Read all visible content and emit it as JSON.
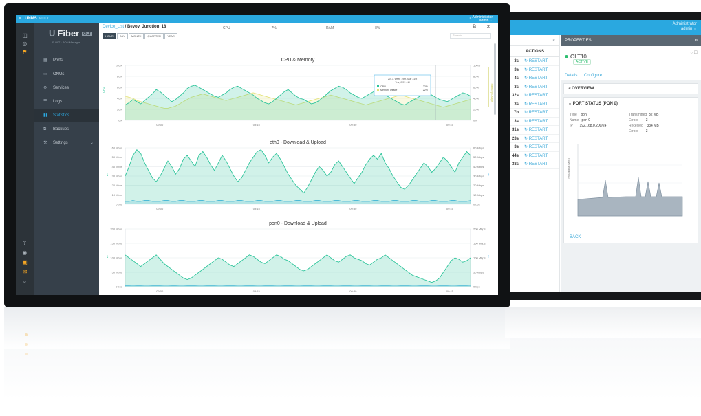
{
  "app": {
    "brand": "UNMS",
    "version": "v1.0.x",
    "user_role": "Administrator",
    "user_name": "admin"
  },
  "logo": {
    "name": "Fiber",
    "badge": "OLT",
    "subtitle": "IP OLT · PON Manager"
  },
  "sidebar": {
    "items": [
      {
        "label": "Ports",
        "icon": "ports-icon"
      },
      {
        "label": "ONUs",
        "icon": "onu-icon"
      },
      {
        "label": "Services",
        "icon": "services-icon"
      },
      {
        "label": "Logs",
        "icon": "logs-icon"
      },
      {
        "label": "Statistics",
        "icon": "statistics-icon",
        "active": true
      },
      {
        "label": "Backups",
        "icon": "backups-icon"
      },
      {
        "label": "Settings",
        "icon": "settings-icon"
      }
    ]
  },
  "header": {
    "breadcrumb_root": "Device_List",
    "breadcrumb_sep": " / ",
    "breadcrumb_current": "Bevov_Junction_18",
    "cpu_label": "CPU",
    "cpu_value": "7%",
    "ram_label": "RAM",
    "ram_value": "8%",
    "range_tabs": [
      "HOUR",
      "DAY",
      "MONTH",
      "QUARTER",
      "YEAR"
    ],
    "active_range": "HOUR",
    "filter_placeholder": "Search"
  },
  "tooltip": {
    "title": "2017, week 19th, Mar 31st",
    "subtitle": "Tue, 9:52 AM",
    "series": [
      {
        "name": "CPU",
        "value": "22%"
      },
      {
        "name": "Memory Usage",
        "value": "22%"
      }
    ]
  },
  "colors": {
    "accent": "#2aa8e0",
    "sidebar": "#36404a",
    "series_green": "#2cc49a",
    "series_yellow": "#e4e37a",
    "series_blue": "#56b8e8"
  },
  "chart_data": [
    {
      "type": "area",
      "title": "CPU & Memory",
      "x": [
        "09:00",
        "09:15",
        "09:30",
        "09:45"
      ],
      "y_ticks": [
        "0%",
        "20%",
        "40%",
        "60%",
        "80%",
        "100%"
      ],
      "ylim": [
        0,
        100
      ],
      "ylabel": "CPU",
      "y2label": "Memory Usage",
      "series": [
        {
          "name": "CPU",
          "values": [
            28,
            32,
            38,
            34,
            30,
            36,
            42,
            48,
            56,
            52,
            46,
            40,
            34,
            38,
            44,
            50,
            58,
            62,
            64,
            60,
            56,
            52,
            48,
            44,
            42,
            46,
            50,
            56,
            60,
            62,
            58,
            54,
            50,
            46,
            40,
            36,
            32,
            30,
            34,
            40,
            46,
            52,
            56,
            50,
            44,
            40,
            38,
            34,
            30,
            32,
            36,
            42,
            48,
            54,
            58,
            62,
            60,
            56,
            50,
            46,
            42,
            40,
            44,
            48,
            52,
            54,
            50,
            46,
            42,
            38,
            34,
            30,
            28,
            32,
            36,
            40,
            44,
            48,
            50,
            46,
            42,
            38,
            36,
            34,
            38,
            42,
            46,
            50,
            48,
            44
          ]
        },
        {
          "name": "Memory Usage",
          "values": [
            44,
            42,
            40,
            36,
            34,
            32,
            30,
            28,
            26,
            24,
            22,
            22,
            24,
            26,
            30,
            34,
            38,
            42,
            44,
            46,
            48,
            46,
            44,
            42,
            40,
            38,
            36,
            38,
            40,
            42,
            44,
            46,
            48,
            50,
            48,
            46,
            44,
            42,
            40,
            38,
            36,
            34,
            32,
            30,
            28,
            30,
            32,
            34,
            36,
            38,
            40,
            42,
            44,
            46,
            44,
            42,
            40,
            38,
            36,
            34,
            32,
            30,
            28,
            30,
            32,
            34,
            36,
            38,
            40,
            42,
            44,
            46,
            44,
            42,
            40,
            38,
            36,
            34,
            32,
            30,
            28,
            26,
            24,
            26,
            28,
            30,
            32,
            34,
            36,
            38
          ]
        }
      ]
    },
    {
      "type": "area",
      "title": "eth0 - Download & Upload",
      "x": [
        "09:00",
        "09:15",
        "09:30",
        "09:45"
      ],
      "y_ticks": [
        "0 bps",
        "10 Mbps",
        "20 Mbps",
        "30 Mbps",
        "40 Mbps",
        "50 Mbps",
        "60 Mbps"
      ],
      "ylim": [
        0,
        60
      ],
      "series": [
        {
          "name": "Download",
          "values": [
            30,
            40,
            52,
            58,
            54,
            44,
            36,
            28,
            24,
            30,
            38,
            46,
            40,
            32,
            38,
            48,
            52,
            46,
            40,
            52,
            56,
            50,
            42,
            36,
            44,
            52,
            46,
            38,
            30,
            24,
            28,
            36,
            44,
            50,
            56,
            58,
            52,
            44,
            50,
            54,
            48,
            40,
            32,
            26,
            20,
            16,
            12,
            18,
            26,
            34,
            40,
            36,
            30,
            34,
            42,
            46,
            40,
            34,
            28,
            22,
            28,
            34,
            42,
            48,
            52,
            48,
            54,
            44,
            38,
            30,
            24,
            18,
            16,
            20,
            26,
            32,
            38,
            44,
            40,
            34,
            38,
            44,
            50,
            46,
            40,
            34,
            44,
            50,
            56,
            52
          ]
        },
        {
          "name": "Upload",
          "values": [
            3,
            3,
            4,
            3,
            3,
            4,
            4,
            3,
            3,
            3,
            4,
            4,
            3,
            3,
            4,
            4,
            3,
            3,
            3,
            4,
            4,
            3,
            3,
            3,
            4,
            4,
            3,
            3,
            3,
            4,
            4,
            3,
            3,
            3,
            4,
            4,
            3,
            3,
            3,
            4,
            4,
            3,
            3,
            3,
            4,
            4,
            3,
            3,
            3,
            4,
            4,
            3,
            3,
            3,
            4,
            4,
            3,
            3,
            3,
            4,
            4,
            3,
            3,
            3,
            4,
            4,
            3,
            3,
            3,
            4,
            4,
            3,
            3,
            3,
            4,
            4,
            3,
            3,
            3,
            4,
            4,
            3,
            3,
            3,
            4,
            4,
            3,
            3,
            3,
            4
          ]
        }
      ]
    },
    {
      "type": "area",
      "title": "pon0 - Download & Upload",
      "x": [
        "09:00",
        "09:15",
        "09:30",
        "09:45"
      ],
      "y_ticks": [
        "0 bps",
        "50 Mbps",
        "100 Mbps",
        "150 Mbps",
        "200 Mbps"
      ],
      "ylim": [
        0,
        200
      ],
      "series": [
        {
          "name": "Download",
          "values": [
            110,
            100,
            90,
            80,
            70,
            80,
            90,
            100,
            110,
            95,
            80,
            70,
            60,
            50,
            40,
            30,
            25,
            30,
            40,
            50,
            60,
            70,
            80,
            90,
            100,
            95,
            85,
            75,
            70,
            80,
            90,
            100,
            110,
            105,
            95,
            85,
            80,
            90,
            100,
            110,
            105,
            95,
            90,
            80,
            70,
            60,
            55,
            60,
            70,
            80,
            90,
            100,
            110,
            100,
            90,
            85,
            95,
            105,
            110,
            100,
            95,
            90,
            80,
            75,
            85,
            95,
            100,
            110,
            100,
            90,
            80,
            70,
            60,
            50,
            40,
            35,
            30,
            25,
            20,
            15,
            20,
            30,
            50,
            70,
            90,
            100,
            95,
            85,
            90,
            100
          ]
        },
        {
          "name": "Upload",
          "values": [
            4,
            4,
            5,
            4,
            4,
            5,
            5,
            4,
            4,
            4,
            5,
            5,
            4,
            4,
            5,
            5,
            4,
            4,
            4,
            5,
            5,
            4,
            4,
            4,
            5,
            5,
            4,
            4,
            4,
            5,
            5,
            4,
            4,
            4,
            5,
            5,
            4,
            4,
            4,
            5,
            5,
            4,
            4,
            4,
            5,
            5,
            4,
            4,
            4,
            5,
            5,
            4,
            4,
            4,
            5,
            5,
            4,
            4,
            4,
            5,
            5,
            4,
            4,
            4,
            5,
            5,
            4,
            4,
            4,
            5,
            5,
            4,
            4,
            4,
            5,
            5,
            4,
            4,
            4,
            5,
            5,
            4,
            4,
            4,
            5,
            5,
            4,
            4,
            4,
            5
          ]
        }
      ]
    }
  ],
  "back_window": {
    "actions_header": "ACTIONS",
    "rows": [
      {
        "suffix": "3s",
        "action": "RESTART"
      },
      {
        "suffix": "3s",
        "action": "RESTART"
      },
      {
        "suffix": "4s",
        "action": "RESTART"
      },
      {
        "suffix": "3s",
        "action": "RESTART"
      },
      {
        "suffix": "32s",
        "action": "RESTART"
      },
      {
        "suffix": "3s",
        "action": "RESTART"
      },
      {
        "suffix": "7h",
        "action": "RESTART"
      },
      {
        "suffix": "3s",
        "action": "RESTART"
      },
      {
        "suffix": "31s",
        "action": "RESTART"
      },
      {
        "suffix": "23s",
        "action": "RESTART"
      },
      {
        "suffix": "3s",
        "action": "RESTART"
      },
      {
        "suffix": "44s",
        "action": "RESTART"
      },
      {
        "suffix": "38s",
        "action": "RESTART"
      }
    ],
    "properties_title": "PROPERTIES",
    "device_name": "OLT10",
    "device_status": "ACTIVE",
    "tabs": [
      "Details",
      "Configure"
    ],
    "overview": "OVERVIEW",
    "port_status": "PORT STATUS (PON 0)",
    "details": [
      {
        "key": "Type",
        "value": "pon"
      },
      {
        "key": "Name",
        "value": "pon 0"
      },
      {
        "key": "IP",
        "value": "192.168.0.200/24"
      }
    ],
    "traffic": [
      {
        "key": "Transmitted",
        "value": "32 MB"
      },
      {
        "key": "Errors",
        "value": "3"
      },
      {
        "key": "Received",
        "value": "334 MB"
      },
      {
        "key": "Errors",
        "value": "3"
      }
    ],
    "chart_ylabel": "Throughput (Mbit)",
    "back_label": "BACK"
  }
}
